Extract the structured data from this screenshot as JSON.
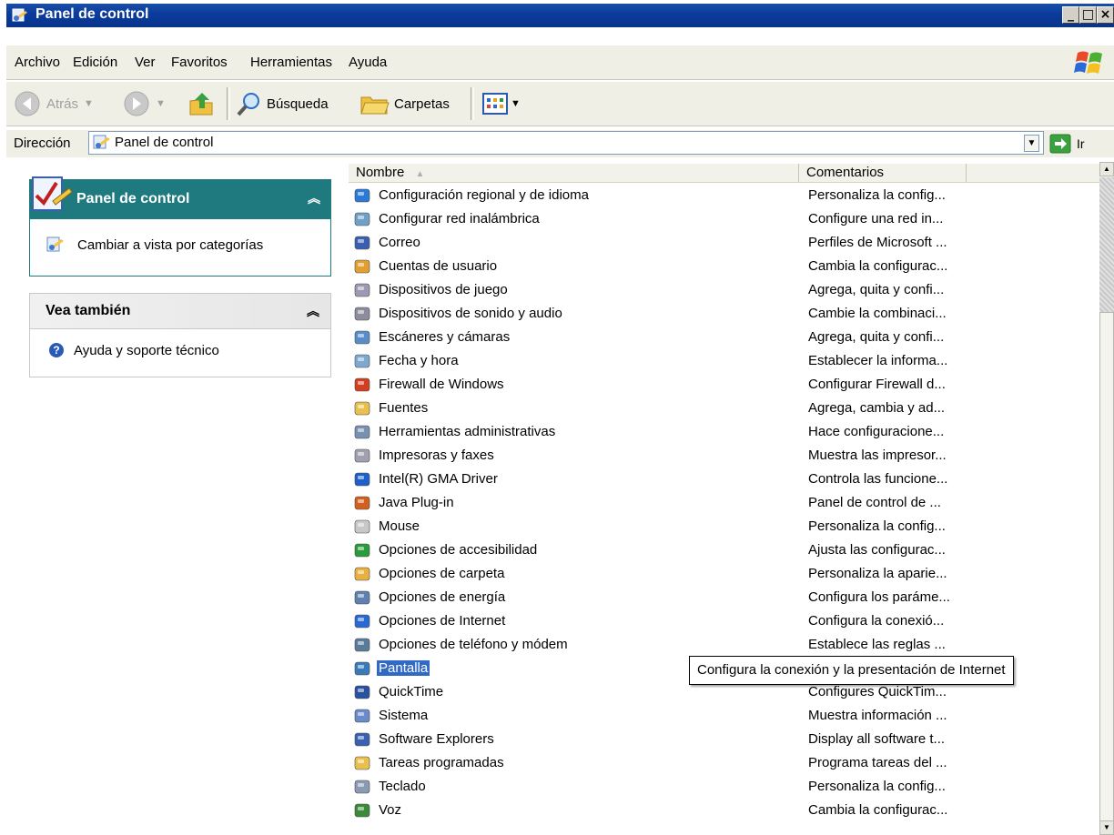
{
  "window": {
    "title": "Panel de control"
  },
  "menu": [
    "Archivo",
    "Edición",
    "Ver",
    "Favoritos",
    "Herramientas",
    "Ayuda"
  ],
  "toolbar": {
    "back": "Atrás",
    "search": "Búsqueda",
    "folders": "Carpetas"
  },
  "address": {
    "label": "Dirección",
    "value": "Panel de control",
    "go": "Ir"
  },
  "sidebar": {
    "panel_title": "Panel de control",
    "switch_view": "Cambiar a vista por categorías",
    "see_also_title": "Vea también",
    "help": "Ayuda y soporte técnico"
  },
  "columns": {
    "name": "Nombre",
    "comments": "Comentarios"
  },
  "items": [
    {
      "name": "Configuración regional y de idioma",
      "comment": "Personaliza la config...",
      "icon": "globe-icon",
      "color": "#2a7ad6"
    },
    {
      "name": "Configurar red inalámbrica",
      "comment": "Configure una red in...",
      "icon": "wireless-network-icon",
      "color": "#6fa0c8"
    },
    {
      "name": "Correo",
      "comment": "Perfiles de Microsoft ...",
      "icon": "mail-icon",
      "color": "#3a5fae"
    },
    {
      "name": "Cuentas de usuario",
      "comment": "Cambia la configurac...",
      "icon": "users-icon",
      "color": "#e0a030"
    },
    {
      "name": "Dispositivos de juego",
      "comment": "Agrega, quita y confi...",
      "icon": "gamepad-icon",
      "color": "#9a9ab0"
    },
    {
      "name": "Dispositivos de sonido y audio",
      "comment": "Cambie la combinaci...",
      "icon": "speaker-icon",
      "color": "#8c8c9c"
    },
    {
      "name": "Escáneres y cámaras",
      "comment": "Agrega, quita y confi...",
      "icon": "scanner-icon",
      "color": "#5a8cc8"
    },
    {
      "name": "Fecha y hora",
      "comment": "Establecer la informa...",
      "icon": "clock-icon",
      "color": "#7fa8d0"
    },
    {
      "name": "Firewall de Windows",
      "comment": "Configurar Firewall d...",
      "icon": "firewall-icon",
      "color": "#d04020"
    },
    {
      "name": "Fuentes",
      "comment": "Agrega, cambia y ad...",
      "icon": "fonts-folder-icon",
      "color": "#e8c050"
    },
    {
      "name": "Herramientas administrativas",
      "comment": "Hace configuracione...",
      "icon": "admin-tools-icon",
      "color": "#7a90b0"
    },
    {
      "name": "Impresoras y faxes",
      "comment": "Muestra las impresor...",
      "icon": "printer-icon",
      "color": "#a0a0b0"
    },
    {
      "name": "Intel(R) GMA Driver",
      "comment": "Controla las funcione...",
      "icon": "intel-gma-icon",
      "color": "#1f5fc8"
    },
    {
      "name": "Java Plug-in",
      "comment": "Panel de control de ...",
      "icon": "java-icon",
      "color": "#d06020"
    },
    {
      "name": "Mouse",
      "comment": "Personaliza la config...",
      "icon": "mouse-icon",
      "color": "#c8c8c8"
    },
    {
      "name": "Opciones de accesibilidad",
      "comment": "Ajusta las configurac...",
      "icon": "accessibility-icon",
      "color": "#2a9a3a"
    },
    {
      "name": "Opciones de carpeta",
      "comment": "Personaliza la aparie...",
      "icon": "folder-options-icon",
      "color": "#e8b040"
    },
    {
      "name": "Opciones de energía",
      "comment": "Configura los paráme...",
      "icon": "power-icon",
      "color": "#6080b0"
    },
    {
      "name": "Opciones de Internet",
      "comment": "Configura la conexió...",
      "icon": "internet-icon",
      "color": "#2a6ad0"
    },
    {
      "name": "Opciones de teléfono y módem",
      "comment": "Establece las reglas ...",
      "icon": "phone-icon",
      "color": "#5a7a9a"
    },
    {
      "name": "Pantalla",
      "comment": "Configura la conexión y la presentación de Internet",
      "icon": "display-icon",
      "color": "#3a7ab8",
      "selected": true
    },
    {
      "name": "QuickTime",
      "comment": "Configures QuickTim...",
      "icon": "quicktime-icon",
      "color": "#2a50a0"
    },
    {
      "name": "Sistema",
      "comment": "Muestra información ...",
      "icon": "system-icon",
      "color": "#6a8ac8"
    },
    {
      "name": "Software Explorers",
      "comment": "Display all software t...",
      "icon": "software-explorers-icon",
      "color": "#3a60b0"
    },
    {
      "name": "Tareas programadas",
      "comment": "Programa tareas del ...",
      "icon": "scheduled-tasks-icon",
      "color": "#e8c050"
    },
    {
      "name": "Teclado",
      "comment": "Personaliza la config...",
      "icon": "keyboard-icon",
      "color": "#8a9ab0"
    },
    {
      "name": "Voz",
      "comment": "Cambia la configurac...",
      "icon": "speech-icon",
      "color": "#3a8a3a"
    }
  ],
  "tooltip": "Configura la conexión y la presentación de Internet"
}
